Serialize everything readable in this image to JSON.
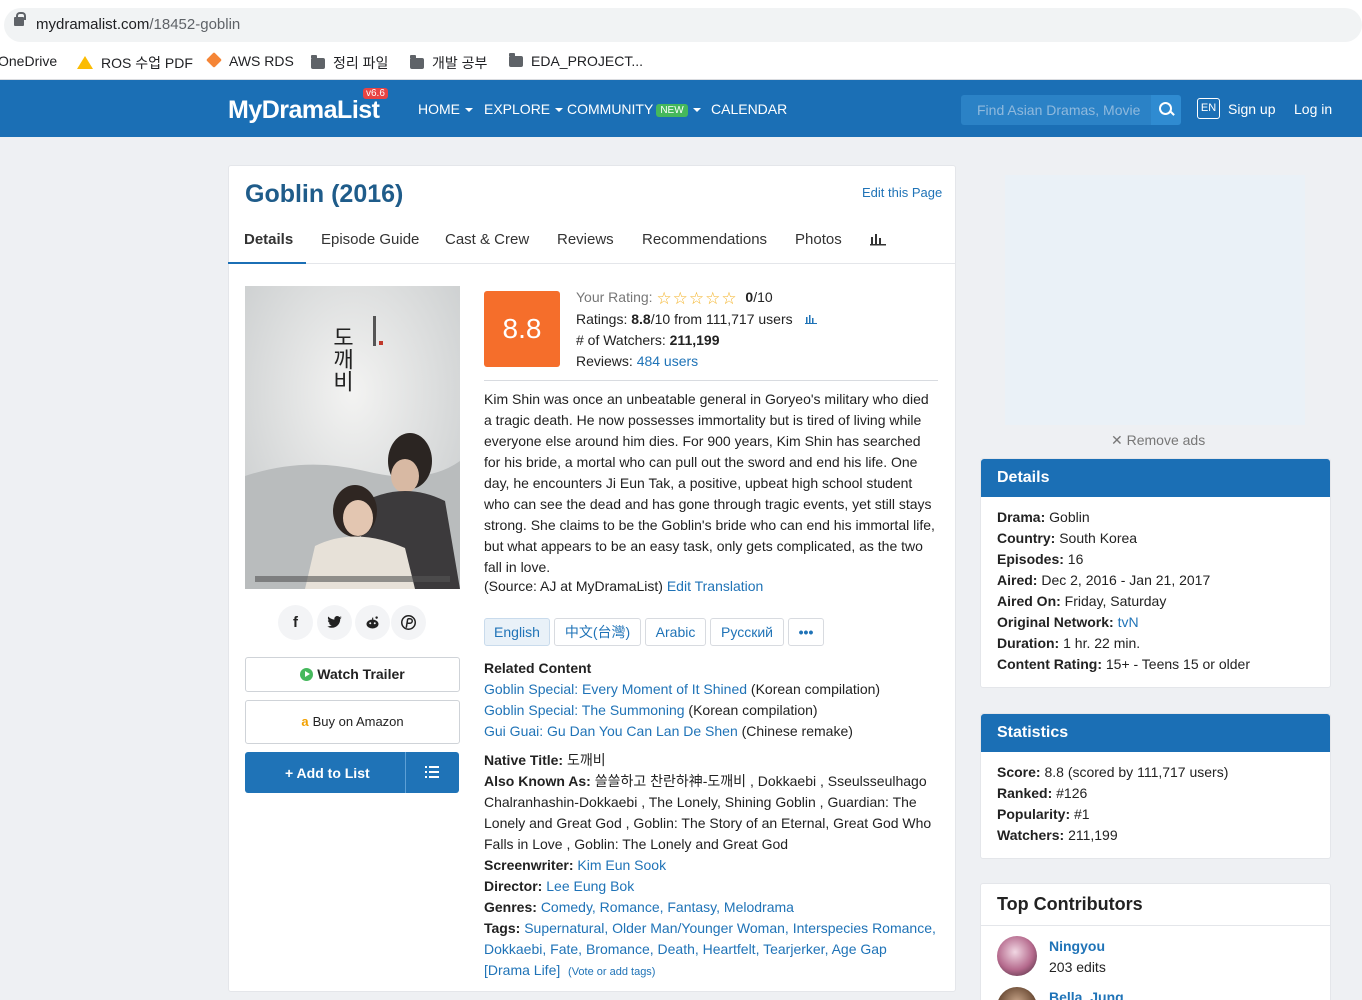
{
  "browser": {
    "url_host": "mydramalist.com",
    "url_path": "/18452-goblin",
    "bookmarks": [
      "OneDrive",
      "ROS 수업 PDF",
      "AWS RDS",
      "정리 파일",
      "개발 공부",
      "EDA_PROJECT..."
    ]
  },
  "header": {
    "logo": "MyDramaList",
    "version": "v6.6",
    "nav": [
      {
        "label": "HOME",
        "dropdown": true
      },
      {
        "label": "EXPLORE",
        "dropdown": true
      },
      {
        "label": "COMMUNITY",
        "dropdown": true,
        "badge": "NEW"
      },
      {
        "label": "CALENDAR",
        "dropdown": false
      }
    ],
    "search_placeholder": "Find Asian Dramas, Movie",
    "lang": "EN",
    "signup": "Sign up",
    "login": "Log in"
  },
  "page": {
    "title": "Goblin (2016)",
    "edit_link": "Edit this Page",
    "tabs": [
      "Details",
      "Episode Guide",
      "Cast & Crew",
      "Reviews",
      "Recommendations",
      "Photos"
    ],
    "active_tab": "Details"
  },
  "poster": {
    "title_hangul": "도깨비"
  },
  "share_icons": [
    "facebook-icon",
    "twitter-icon",
    "reddit-icon",
    "pinterest-icon"
  ],
  "actions": {
    "watch_trailer": "Watch Trailer",
    "buy_amazon": "Buy on Amazon",
    "add_to_list": "Add to List"
  },
  "rating": {
    "score": "8.8",
    "your_rating_label": "Your Rating:",
    "your_rating_value": "0",
    "your_rating_max": "/10",
    "ratings_label": "Ratings:",
    "ratings_value": "8.8",
    "ratings_suffix": "/10 from 111,717 users",
    "watchers_label": "# of Watchers:",
    "watchers_value": "211,199",
    "reviews_label": "Reviews:",
    "reviews_value": "484 users"
  },
  "synopsis": "Kim Shin was once an unbeatable general in Goryeo's military who died a tragic death. He now possesses immortality but is tired of living while everyone else around him dies. For 900 years, Kim Shin has searched for his bride, a mortal who can pull out the sword and end his life. One day, he encounters Ji Eun Tak, a positive, upbeat high school student who can see the dead and has gone through tragic events, yet still stays strong. She claims to be the Goblin's bride who can end his immortal life, but what appears to be an easy task, only gets complicated, as the two fall in love.",
  "source": {
    "text": "(Source: AJ at MyDramaList)",
    "link": "Edit Translation"
  },
  "languages": [
    "English",
    "中文(台灣)",
    "Arabic",
    "Русский",
    "•••"
  ],
  "related": {
    "heading": "Related Content",
    "items": [
      {
        "title": "Goblin Special: Every Moment of It Shined",
        "note": "(Korean compilation)"
      },
      {
        "title": "Goblin Special: The Summoning",
        "note": "(Korean compilation)"
      },
      {
        "title": "Gui Guai: Gu Dan You Can Lan De Shen",
        "note": "(Chinese remake)"
      }
    ]
  },
  "info": {
    "native_title_label": "Native Title:",
    "native_title": "도깨비",
    "aka_label": "Also Known As:",
    "aka": "쓸쓸하고 찬란하神-도깨비 , Dokkaebi , Sseulsseulhago Chalranhashin-Dokkaebi , The Lonely, Shining Goblin , Guardian: The Lonely and Great God , Goblin: The Story of an Eternal, Great God Who Falls in Love , Goblin: The Lonely and Great God",
    "screenwriter_label": "Screenwriter:",
    "screenwriter": "Kim Eun Sook",
    "director_label": "Director:",
    "director": "Lee Eung Bok",
    "genres_label": "Genres:",
    "genres": "Comedy, Romance, Fantasy, Melodrama",
    "tags_label": "Tags:",
    "tags": "Supernatural, Older Man/Younger Woman, Interspecies Romance, Dokkaebi, Fate, Bromance, Death, Heartfelt, Tearjerker, Age Gap [Drama Life]",
    "tags_vote": "(Vote or add tags)"
  },
  "sidebar": {
    "remove_ads": "Remove ads",
    "details": {
      "heading": "Details",
      "rows": [
        {
          "label": "Drama:",
          "value": "Goblin"
        },
        {
          "label": "Country:",
          "value": "South Korea"
        },
        {
          "label": "Episodes:",
          "value": "16"
        },
        {
          "label": "Aired:",
          "value": "Dec 2, 2016 - Jan 21, 2017"
        },
        {
          "label": "Aired On:",
          "value": "Friday, Saturday"
        },
        {
          "label": "Original Network:",
          "value": "tvN"
        },
        {
          "label": "Duration:",
          "value": "1 hr. 22 min."
        },
        {
          "label": "Content Rating:",
          "value": "15+ - Teens 15 or older"
        }
      ]
    },
    "statistics": {
      "heading": "Statistics",
      "rows": [
        {
          "label": "Score:",
          "value": "8.8 (scored by 111,717 users)"
        },
        {
          "label": "Ranked:",
          "value": "#126"
        },
        {
          "label": "Popularity:",
          "value": "#1"
        },
        {
          "label": "Watchers:",
          "value": "211,199"
        }
      ]
    },
    "contributors": {
      "heading": "Top Contributors",
      "items": [
        {
          "name": "Ningyou",
          "edits": "203 edits"
        },
        {
          "name": "Bella_Jung",
          "edits": ""
        }
      ]
    }
  }
}
